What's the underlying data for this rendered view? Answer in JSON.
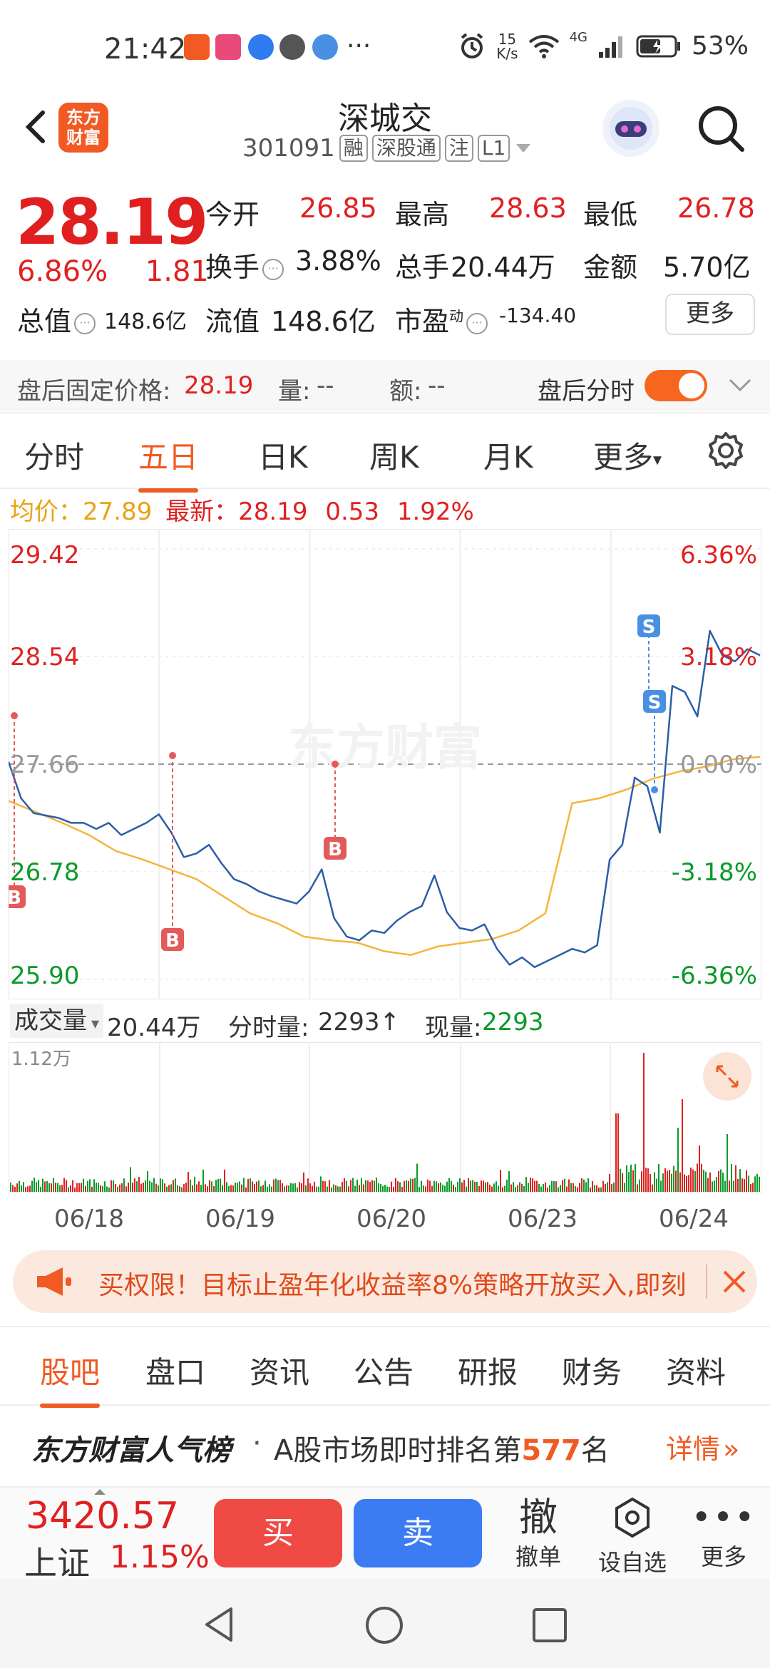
{
  "status_bar": {
    "time": "21:42",
    "net_speed_value": "15",
    "net_speed_unit": "K/s",
    "net_type": "4G",
    "battery": "53%",
    "more": "···"
  },
  "header": {
    "logo_line1": "东方",
    "logo_line2": "财富",
    "title": "深城交",
    "code": "301091",
    "tags": [
      "融",
      "深股通",
      "注",
      "L1"
    ]
  },
  "quote": {
    "price": "28.19",
    "change_pct": "6.86%",
    "change": "1.81",
    "open_label": "今开",
    "open": "26.85",
    "high_label": "最高",
    "high": "28.63",
    "low_label": "最低",
    "low": "26.78",
    "turnover_label": "换手",
    "turnover": "3.88%",
    "volume_label": "总手",
    "volume": "20.44万",
    "amount_label": "金额",
    "amount": "5.70亿",
    "mktcap_label": "总值",
    "mktcap": "148.6亿",
    "float_label": "流值",
    "float": "148.6亿",
    "pe_label": "市盈",
    "pe_sup": "动",
    "pe": "-134.40",
    "more": "更多"
  },
  "after_hours": {
    "label": "盘后固定价格:",
    "price": "28.19",
    "vol_label": "量:",
    "vol": "--",
    "amt_label": "额:",
    "amt": "--",
    "toggle_label": "盘后分时"
  },
  "period_tabs": [
    "分时",
    "五日",
    "日K",
    "周K",
    "月K",
    "更多"
  ],
  "legend": {
    "avg_label": "均价：",
    "avg": "27.89",
    "latest_label": "最新：",
    "latest": "28.19",
    "chg": "0.53",
    "pct": "1.92%"
  },
  "watermark": "东方财富",
  "chart_data": {
    "type": "line",
    "title": "",
    "x": [
      "06/18",
      "06/19",
      "06/20",
      "06/23",
      "06/24"
    ],
    "y_ticks_left": [
      "29.42",
      "28.54",
      "27.66",
      "26.78",
      "25.90"
    ],
    "y_ticks_right": [
      "6.36%",
      "3.18%",
      "0.00%",
      "-3.18%",
      "-6.36%"
    ],
    "ylim": [
      25.9,
      29.42
    ],
    "prev_close": 27.66,
    "grid": true,
    "series": [
      {
        "role": "price",
        "color": "#2b5ea7",
        "values": [
          27.68,
          27.38,
          27.26,
          27.24,
          27.22,
          27.18,
          27.18,
          27.13,
          27.18,
          27.08,
          27.13,
          27.18,
          27.25,
          27.1,
          26.9,
          26.93,
          27.0,
          26.85,
          26.72,
          26.68,
          26.62,
          26.58,
          26.55,
          26.52,
          26.62,
          26.8,
          26.4,
          26.25,
          26.22,
          26.3,
          26.28,
          26.38,
          26.45,
          26.5,
          26.75,
          26.45,
          26.32,
          26.3,
          26.35,
          26.15,
          26.02,
          26.08,
          26.0,
          26.05,
          26.1,
          26.15,
          26.12,
          26.18,
          26.88,
          27.0,
          27.55,
          27.48,
          27.1,
          28.3,
          28.25,
          28.05,
          28.75,
          28.55,
          28.5,
          28.6,
          28.55
        ]
      },
      {
        "role": "average",
        "color": "#f5b53d",
        "values": [
          27.36,
          27.27,
          27.18,
          27.08,
          26.95,
          26.88,
          26.8,
          26.72,
          26.58,
          26.44,
          26.36,
          26.25,
          26.22,
          26.2,
          26.13,
          26.1,
          26.17,
          26.2,
          26.23,
          26.3,
          26.44,
          27.34,
          27.38,
          27.45,
          27.54,
          27.6,
          27.64,
          27.7,
          27.72
        ]
      }
    ],
    "markers": [
      {
        "label": "B",
        "color": "#e45a5a"
      },
      {
        "label": "B",
        "color": "#e45a5a"
      },
      {
        "label": "B",
        "color": "#e45a5a"
      },
      {
        "label": "S",
        "color": "#4a90e2"
      },
      {
        "label": "S",
        "color": "#4a90e2"
      }
    ]
  },
  "volume_bar": {
    "selector_label": "成交量",
    "total": "20.44万",
    "tick_label": "分时量:",
    "tick": "2293",
    "tick_arrow": "↑",
    "now_label": "现量:",
    "now": "2293",
    "ymax": "1.12万"
  },
  "banner": {
    "text": "买权限！目标止盈年化收益率8%策略开放买入,即刻"
  },
  "bottom_tabs": [
    "股吧",
    "盘口",
    "资讯",
    "公告",
    "研报",
    "财务",
    "资料"
  ],
  "popularity": {
    "brand": "东方财富人气榜",
    "sep": "·",
    "text_prefix": "A股市场即时排名第",
    "rank": "577",
    "text_suffix": "名",
    "details": "详情"
  },
  "trade_bar": {
    "index_value": "3420.57",
    "index_name": "上证",
    "index_pct": "1.15%",
    "buy": "买",
    "sell": "卖",
    "cancel_icon_text": "撤",
    "cancel": "撤单",
    "watchlist": "设自选",
    "more": "更多"
  },
  "colors": {
    "accent": "#f15a22",
    "up": "#e02020",
    "down": "#0a9a2a",
    "buy": "#f04a44",
    "sell": "#3b7cf2"
  }
}
